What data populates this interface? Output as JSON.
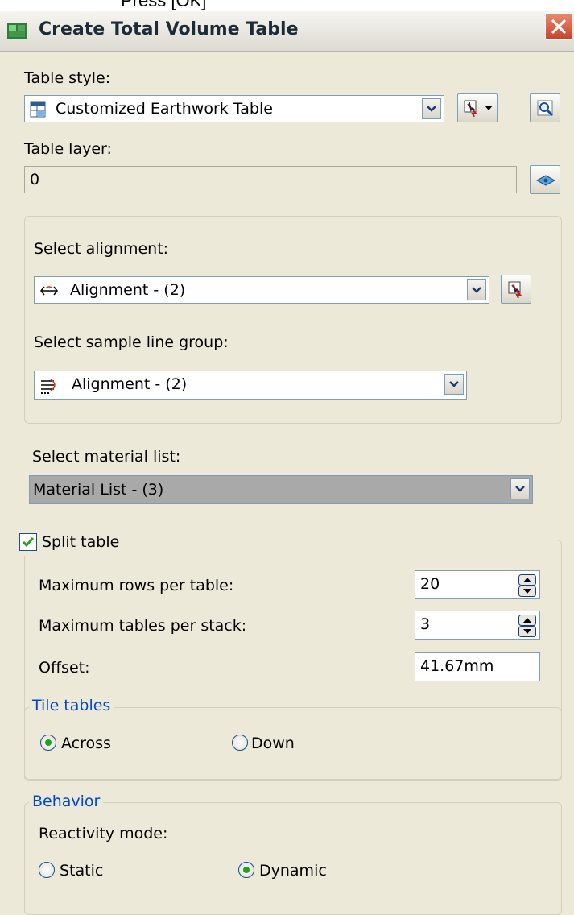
{
  "window": {
    "top_cut_text": "Press [OK]",
    "title": "Create Total Volume Table",
    "close_icon": "close-icon"
  },
  "table_style": {
    "label": "Table style:",
    "value": "Customized Earthwork Table"
  },
  "table_layer": {
    "label": "Table layer:",
    "value": "0"
  },
  "alignment": {
    "label": "Select alignment:",
    "value": "Alignment - (2)"
  },
  "sample_line_group": {
    "label": "Select sample line group:",
    "value": "Alignment - (2)"
  },
  "material_list": {
    "label": "Select material list:",
    "value": "Material List - (3)"
  },
  "split_table": {
    "label": "Split table",
    "checked": true,
    "max_rows_label": "Maximum rows per table:",
    "max_rows_value": "20",
    "max_tables_label": "Maximum tables per stack:",
    "max_tables_value": "3",
    "offset_label": "Offset:",
    "offset_value": "41.67mm"
  },
  "tile_tables": {
    "legend": "Tile tables",
    "across_label": "Across",
    "down_label": "Down",
    "selected": "Across"
  },
  "behavior": {
    "legend": "Behavior",
    "mode_label": "Reactivity mode:",
    "static_label": "Static",
    "dynamic_label": "Dynamic",
    "selected": "Dynamic"
  },
  "colors": {
    "dialog_bg": "#ece9d8",
    "group_legend": "#0046d5",
    "close_red": "#c8412a"
  }
}
